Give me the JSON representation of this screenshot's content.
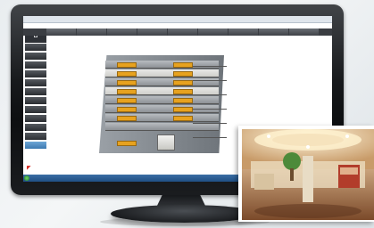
{
  "app": {
    "title": ""
  },
  "menu": {
    "tabs": [
      "",
      "",
      "",
      "",
      "",
      "",
      "",
      "",
      ""
    ]
  },
  "sidebar": {
    "items": [
      "",
      "",
      "",
      "",
      "",
      "",
      "",
      "",
      "",
      "",
      "",
      ""
    ],
    "active_index": 11
  },
  "brand": {
    "name": ""
  },
  "panel": {
    "title_left": "",
    "title_right": ""
  },
  "floors": [
    {
      "left_chip": "",
      "right_chip": "",
      "label": ""
    },
    {
      "left_chip": "",
      "right_chip": "",
      "label": ""
    },
    {
      "left_chip": "",
      "right_chip": "",
      "label": ""
    },
    {
      "left_chip": "",
      "right_chip": "",
      "label": ""
    },
    {
      "left_chip": "",
      "right_chip": "",
      "label": ""
    },
    {
      "left_chip": "",
      "right_chip": "",
      "label": ""
    },
    {
      "left_chip": "",
      "right_chip": "",
      "label": ""
    },
    {
      "left_chip": "",
      "right_chip": "",
      "label": ""
    }
  ],
  "colors": {
    "accent": "#e7a21f",
    "menubar": "#3a3d42",
    "taskbar": "#1f4f84",
    "sidebar_active": "#3c78b0",
    "brand": "#1f4e8c"
  },
  "photo": {
    "subject": "hotel-lobby"
  }
}
